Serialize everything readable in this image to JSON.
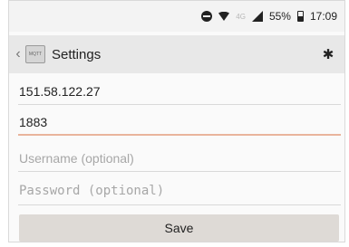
{
  "status_bar": {
    "network_label": "4G",
    "battery_percent": "55%",
    "time": "17:09",
    "icons": [
      "do-not-disturb-icon",
      "wifi-icon",
      "signal-icon",
      "battery-icon"
    ]
  },
  "action_bar": {
    "back_glyph": "‹",
    "app_icon_text": "MQTT",
    "title": "Settings",
    "overflow_glyph": "✱"
  },
  "form": {
    "host_value": "151.58.122.27",
    "port_value": "1883",
    "username_placeholder": "Username (optional)",
    "password_placeholder": "Password (optional)",
    "save_label": "Save"
  },
  "colors": {
    "focus_underline": "#e9b49c",
    "save_button_bg": "#dedad6"
  }
}
